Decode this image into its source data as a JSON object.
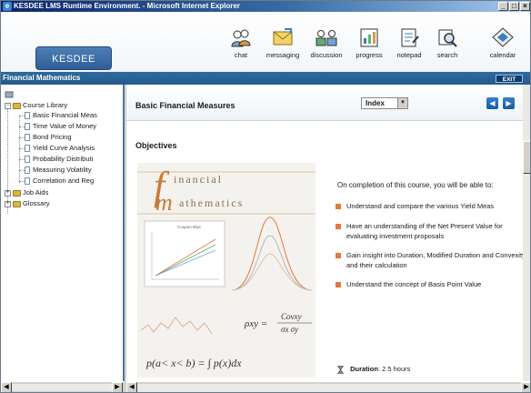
{
  "window": {
    "title": "KESDEE LMS Runtime Environment. - Microsoft Internet Explorer",
    "controls": [
      "_",
      "□",
      "×"
    ]
  },
  "header": {
    "logo_text": "KESDEE",
    "tools": [
      {
        "label": "chat",
        "icon": "chat-icon"
      },
      {
        "label": "messaging",
        "icon": "envelope-icon"
      },
      {
        "label": "discussion",
        "icon": "discussion-icon"
      },
      {
        "label": "progress",
        "icon": "progress-chart-icon"
      },
      {
        "label": "notepad",
        "icon": "notepad-icon"
      },
      {
        "label": "search",
        "icon": "search-icon"
      },
      {
        "label": "calendar",
        "icon": "calendar-icon"
      }
    ]
  },
  "course_bar": {
    "title": "Financial Mathematics",
    "exit_label": "EXIT"
  },
  "sidebar": {
    "root": "Course Library",
    "chapters": [
      "Basic Financial Meas",
      "Time Value of Money",
      "Bond Pricing",
      "Yield Curve Analysis",
      "Probability Distributi",
      "Measuring Volatility",
      "Correlation and Reg"
    ],
    "other_nodes": [
      "Job Aids",
      "Glossary"
    ]
  },
  "main": {
    "section_title": "Basic Financial Measures",
    "index_label": "Index",
    "objectives_heading": "Objectives",
    "intro": "On completion of this course, you will be able to:",
    "objectives": [
      "Understand and compare the various Yield Meas",
      "Have an understanding of the Net Present Value for evaluating investment proposals",
      "Gain insight into Duration, Modified Duration and Convexity and their calculation",
      "Understand the concept of Basis Point Value"
    ],
    "duration_label": "Duration",
    "duration_value": ": 2.5 hours"
  },
  "figure": {
    "brand_f": "f",
    "brand_m": "m",
    "word_1": "inancial",
    "word_2": "athematics",
    "mini_chart_title": "Coupon Bias",
    "formula_rho": "ρxy =",
    "formula_cov": "Covxy",
    "formula_den": "σx σy",
    "formula_prob": "p(a< x< b) = ∫ p(x)dx"
  },
  "colors": {
    "title_blue": "#0a246a",
    "bar_blue": "#2f6b9f",
    "bullet_orange": "#e07a3a"
  }
}
